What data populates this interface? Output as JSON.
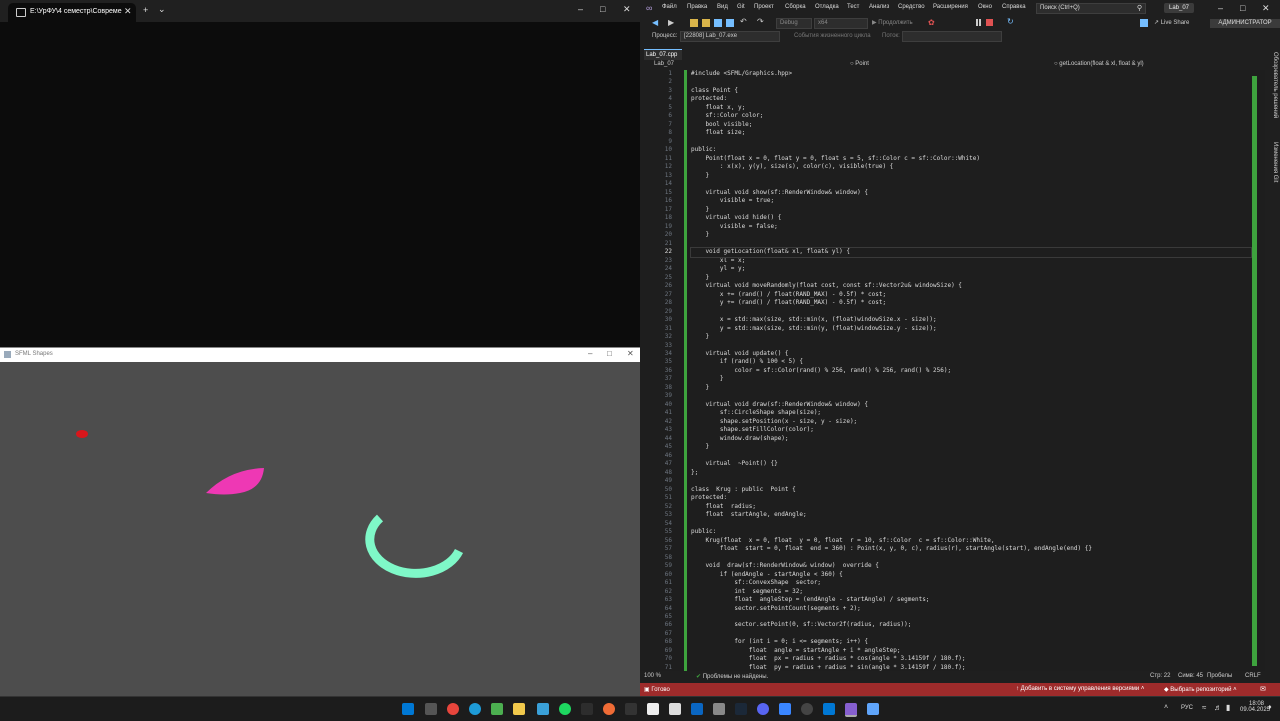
{
  "terminal": {
    "tab_title": "E:\\УрФУ\\4 семестр\\Совреме",
    "close_glyph": "✕",
    "new_tab_glyph": "+",
    "dropdown_glyph": "⌄"
  },
  "sfml": {
    "title": "SFML Shapes",
    "shapes": [
      {
        "kind": "ellipse",
        "color": "#d8161b"
      },
      {
        "kind": "sector",
        "color": "#ee38b4"
      },
      {
        "kind": "arc",
        "color": "#7ff8c8"
      }
    ],
    "background": "#4d4d4d"
  },
  "vs": {
    "menu": [
      "Файл",
      "Правка",
      "Вид",
      "Git",
      "Проект",
      "Сборка",
      "Отладка",
      "Тест",
      "Анализ",
      "Средство",
      "Расширения",
      "Окно",
      "Справка"
    ],
    "search_placeholder": "Поиск (Ctrl+Q)",
    "solution_name": "Lab_07",
    "toolbar": {
      "config": "Debug",
      "platform": "x64",
      "continue_label": "Продолжить",
      "live_share": "Live Share",
      "admin": "АДМИНИСТРАТОР"
    },
    "process_label": "Процесс:",
    "process_value": "[22808] Lab_07.exe",
    "lifecycle_label": "События жизненного цикла",
    "thread_label": "Поток:",
    "doc_tab": "Lab_07.cpp",
    "nav": {
      "project": "Lab_07",
      "scope": "Point",
      "member": "getLocation(float & xl, float & yl)"
    },
    "side_tabs": [
      "Обозреватель решений",
      "Изменения Git"
    ],
    "code_lines": [
      "#include <SFML/Graphics.hpp>",
      "",
      "class Point {",
      "protected:",
      "    float x, y;",
      "    sf::Color color;",
      "    bool visible;",
      "    float size;",
      "",
      "public:",
      "    Point(float x = 0, float y = 0, float s = 5, sf::Color c = sf::Color::White)",
      "        : x(x), y(y), size(s), color(c), visible(true) {",
      "    }",
      "",
      "    virtual void show(sf::RenderWindow& window) {",
      "        visible = true;",
      "    }",
      "    virtual void hide() {",
      "        visible = false;",
      "    }",
      "",
      "    void getLocation(float& xl, float& yl) {",
      "        xl = x;",
      "        yl = y;",
      "    }",
      "    virtual void moveRandomly(float cost, const sf::Vector2u& windowSize) {",
      "        x += (rand() / float(RAND_MAX) - 0.5f) * cost;",
      "        y += (rand() / float(RAND_MAX) - 0.5f) * cost;",
      "",
      "        x = std::max(size, std::min(x, (float)windowSize.x - size));",
      "        y = std::max(size, std::min(y, (float)windowSize.y - size));",
      "    }",
      "",
      "    virtual void update() {",
      "        if (rand() % 100 < 5) {",
      "            color = sf::Color(rand() % 256, rand() % 256, rand() % 256);",
      "        }",
      "    }",
      "",
      "    virtual void draw(sf::RenderWindow& window) {",
      "        sf::CircleShape shape(size);",
      "        shape.setPosition(x - size, y - size);",
      "        shape.setFillColor(color);",
      "        window.draw(shape);",
      "    }",
      "",
      "    virtual  ~Point() {}",
      "};",
      "",
      "class  Krug : public  Point {",
      "protected:",
      "    float  radius;",
      "    float  startAngle, endAngle;",
      "",
      "public:",
      "    Krug(float  x = 0, float  y = 0, float  r = 10, sf::Color  c = sf::Color::White,",
      "        float  start = 0, float  end = 360) : Point(x, y, 0, c), radius(r), startAngle(start), endAngle(end) {}",
      "",
      "    void  draw(sf::RenderWindow& window)  override {",
      "        if (endAngle - startAngle < 360) {",
      "            sf::ConvexShape  sector;",
      "            int  segments = 32;",
      "            float  angleStep = (endAngle - startAngle) / segments;",
      "            sector.setPointCount(segments + 2);",
      "",
      "            sector.setPoint(0, sf::Vector2f(radius, radius));",
      "",
      "            for (int i = 0; i <= segments; i++) {",
      "                float  angle = startAngle + i * angleStep;",
      "                float  px = radius + radius * cos(angle * 3.14159f / 180.f);",
      "                float  py = radius + radius * sin(angle * 3.14159f / 180.f);"
    ],
    "current_line": 22,
    "status": {
      "zoom": "100 %",
      "issues": "Проблемы не найдены.",
      "line": "Стр: 22",
      "col": "Симв: 45",
      "spaces": "Пробелы",
      "eol": "CRLF"
    },
    "bottom": {
      "ready": "Готово",
      "add_vcs": "Добавить в систему управления версиями",
      "repo": "Выбрать репозиторий"
    }
  },
  "taskbar": {
    "lang": "РУС",
    "time": "18:08",
    "date": "09.04.2025"
  }
}
